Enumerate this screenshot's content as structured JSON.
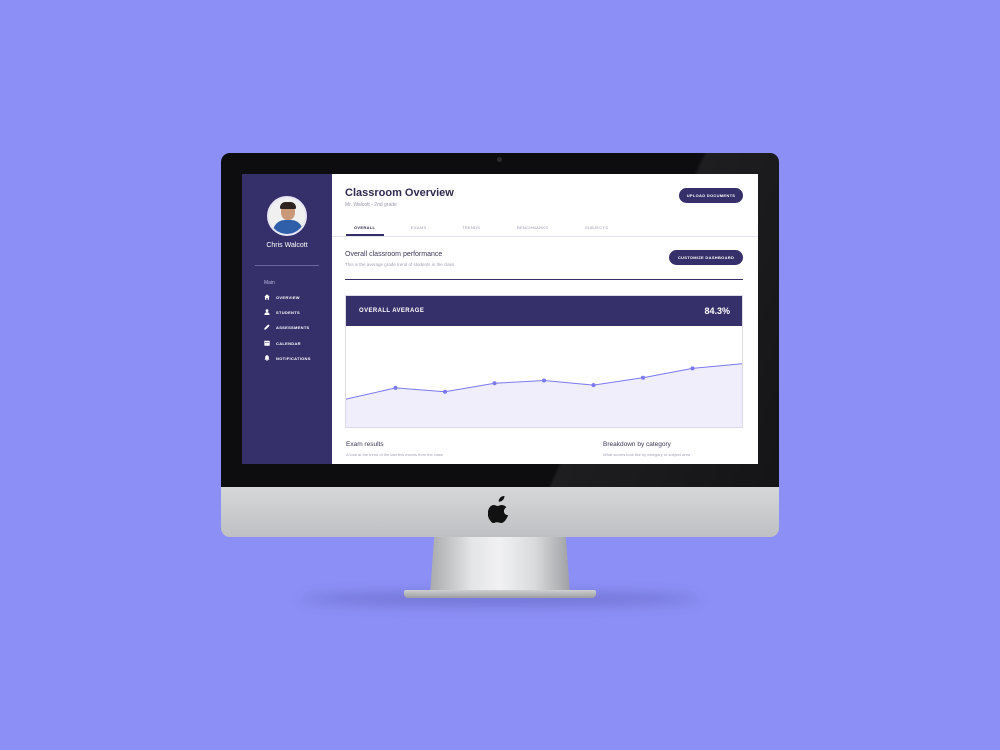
{
  "colors": {
    "background": "#8c8ff5",
    "sidebar": "#36306a",
    "accent": "#36306a",
    "line": "#7b78f0",
    "fill": "#efeefa"
  },
  "sidebar": {
    "user_name": "Chris Walcott",
    "section_label": "Main",
    "items": [
      {
        "label": "OVERVIEW",
        "icon": "home-icon"
      },
      {
        "label": "STUDENTS",
        "icon": "user-icon"
      },
      {
        "label": "ASSESSMENTS",
        "icon": "pencil-icon"
      },
      {
        "label": "CALENDAR",
        "icon": "calendar-icon"
      },
      {
        "label": "NOTIFICATIONS",
        "icon": "bell-icon"
      }
    ]
  },
  "header": {
    "title": "Classroom Overview",
    "subtitle": "Mr. Walcott - 2nd grade",
    "upload_button": "UPLOAD DOCUMENTS"
  },
  "tabs": [
    {
      "label": "OVERALL",
      "active": true
    },
    {
      "label": "EXAMS",
      "active": false
    },
    {
      "label": "TRENDS",
      "active": false
    },
    {
      "label": "BENCHMARKS",
      "active": false
    },
    {
      "label": "SUBJECTS",
      "active": false
    }
  ],
  "performance": {
    "title": "Overall classroom performance",
    "subtitle": "This is the average grade trend of students in the class",
    "customize_button": "CUSTOMIZE DASHBOARD"
  },
  "average_card": {
    "title": "OVERALL AVERAGE",
    "value": "84.3%"
  },
  "chart_data": {
    "type": "area",
    "values": [
      0.3,
      0.42,
      0.38,
      0.47,
      0.5,
      0.45,
      0.53,
      0.63,
      0.68
    ]
  },
  "sections": {
    "exam_title": "Exam results",
    "exam_sub": "A look at the trend of the last few exams from the class",
    "breakdown_title": "Breakdown by category",
    "breakdown_sub": "What scores look like by category or subject area"
  }
}
